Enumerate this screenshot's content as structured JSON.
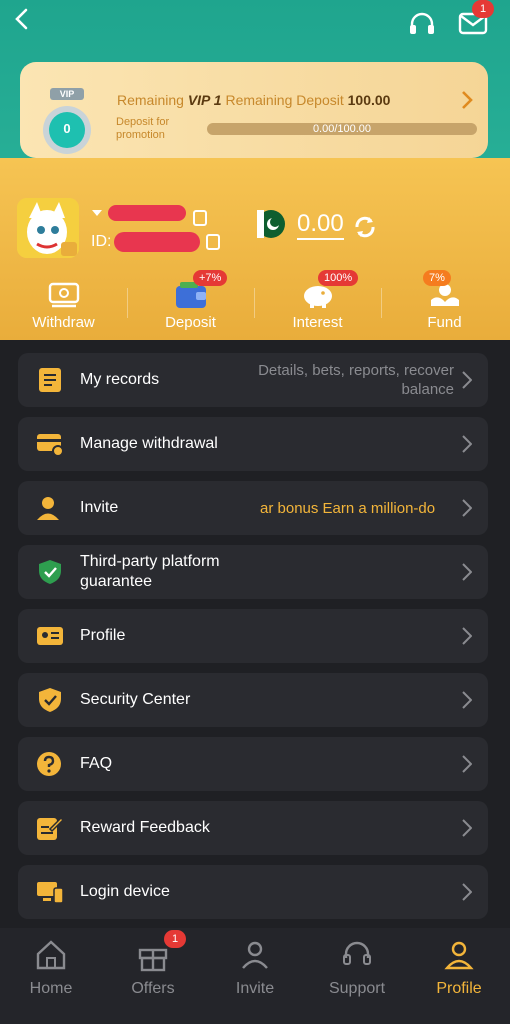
{
  "header": {
    "mail_badge": "1"
  },
  "vip": {
    "remaining_label": "Remaining",
    "vip_level": "VIP 1",
    "remaining_deposit_label": "Remaining Deposit",
    "remaining_deposit_value": "100.00",
    "medal_level": "0",
    "medal_tag": "VIP",
    "promo_label": "Deposit for promotion",
    "progress_text": "0.00/100.00",
    "progress_fraction": 0
  },
  "user": {
    "id_label": "ID:",
    "balance": "0.00"
  },
  "actions": [
    {
      "label": "Withdraw",
      "badge": ""
    },
    {
      "label": "Deposit",
      "badge": "+7%"
    },
    {
      "label": "Interest",
      "badge": "100%"
    },
    {
      "label": "Fund",
      "badge": "7%"
    }
  ],
  "menu": [
    {
      "label": "My records",
      "desc": "Details, bets, reports, recover balance"
    },
    {
      "label": "Manage withdrawal"
    },
    {
      "label": "Invite",
      "promo": "ar bonus  Earn a million-do"
    },
    {
      "label": "Third-party platform guarantee"
    },
    {
      "label": "Profile"
    },
    {
      "label": "Security Center"
    },
    {
      "label": "FAQ"
    },
    {
      "label": "Reward Feedback"
    },
    {
      "label": "Login device"
    }
  ],
  "tabs": [
    {
      "label": "Home"
    },
    {
      "label": "Offers",
      "badge": "1"
    },
    {
      "label": "Invite"
    },
    {
      "label": "Support"
    },
    {
      "label": "Profile"
    }
  ],
  "colors": {
    "accent": "#f3b53a",
    "teal": "#2bb39a",
    "badge": "#e53935",
    "background": "#1f2024"
  }
}
